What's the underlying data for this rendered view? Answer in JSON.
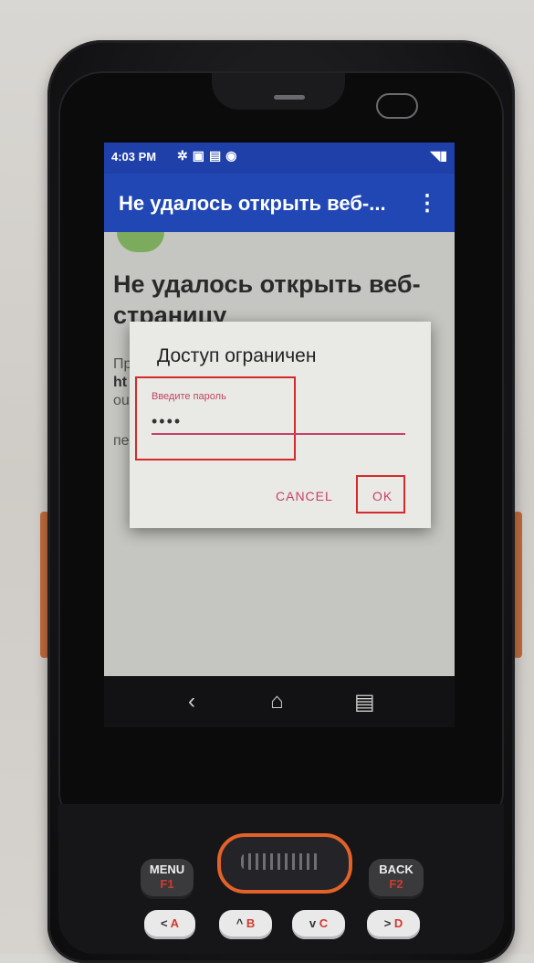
{
  "status_bar": {
    "time": "4:03 PM",
    "left_icons": [
      "settings-icon",
      "notification-icon",
      "image-icon",
      "shield-icon"
    ],
    "right_icons": [
      "wifi-icon",
      "battery-icon"
    ]
  },
  "app_bar": {
    "title": "Не удалось открыть веб-...",
    "menu_glyph": "⋮"
  },
  "page": {
    "heading": "Не удалось открыть веб-страницу",
    "partial_lines": [
      "Пр",
      "ht",
      "ou",
      "пе"
    ]
  },
  "dialog": {
    "title": "Доступ ограничен",
    "field_label": "Введите пароль",
    "password_value": "••••",
    "cancel_label": "CANCEL",
    "ok_label": "OK"
  },
  "nav_bar": {
    "back_glyph": "‹",
    "home_glyph": "⌂",
    "recent_glyph": "▤"
  },
  "hardware_keys": {
    "menu": {
      "label": "MENU",
      "sub": "F1"
    },
    "back": {
      "label": "BACK",
      "sub": "F2"
    },
    "left": {
      "label": "<",
      "sub": "A"
    },
    "up": {
      "label": "^",
      "sub": "B"
    },
    "down": {
      "label": "v",
      "sub": "C"
    },
    "right": {
      "label": ">",
      "sub": "D"
    }
  },
  "colors": {
    "status_bar": "#1e40a8",
    "app_bar": "#2047b4",
    "accent": "#c9406a",
    "highlight": "#d42a2a",
    "scan_ring": "#e2622a"
  }
}
